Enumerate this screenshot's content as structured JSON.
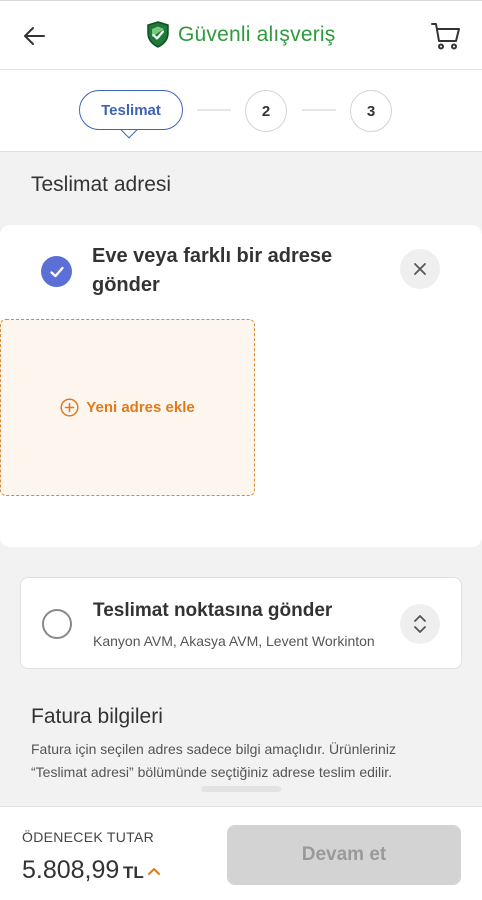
{
  "header": {
    "title": "Güvenli alışveriş",
    "brand_color": "#2e9a3d",
    "back_icon": "arrow-left-icon",
    "shield_icon": "shield-check-icon",
    "cart_icon": "cart-icon"
  },
  "stepper": {
    "active_label": "Teslimat",
    "step2": "2",
    "step3": "3",
    "accent": "#3e63b8"
  },
  "delivery": {
    "section_title": "Teslimat adresi",
    "home_option": {
      "title": "Eve veya farklı bir adrese gönder",
      "selected": true
    },
    "add_address_label": "Yeni adres ekle",
    "pickup_option": {
      "title": "Teslimat noktasına gönder",
      "subtitle": "Kanyon AVM, Akasya AVM, Levent Workinton",
      "selected": false
    }
  },
  "invoice": {
    "title": "Fatura bilgileri",
    "description": "Fatura için seçilen adres sadece bilgi amaçlıdır. Ürünleriniz “Teslimat adresi” bölümünde seçtiğiniz adrese teslim edilir."
  },
  "footer": {
    "total_label": "ÖDENECEK TUTAR",
    "amount": "5.808,99",
    "currency": "TL",
    "continue_label": "Devam et"
  },
  "colors": {
    "orange": "#e07b1a",
    "check": "#5b6fd6"
  }
}
